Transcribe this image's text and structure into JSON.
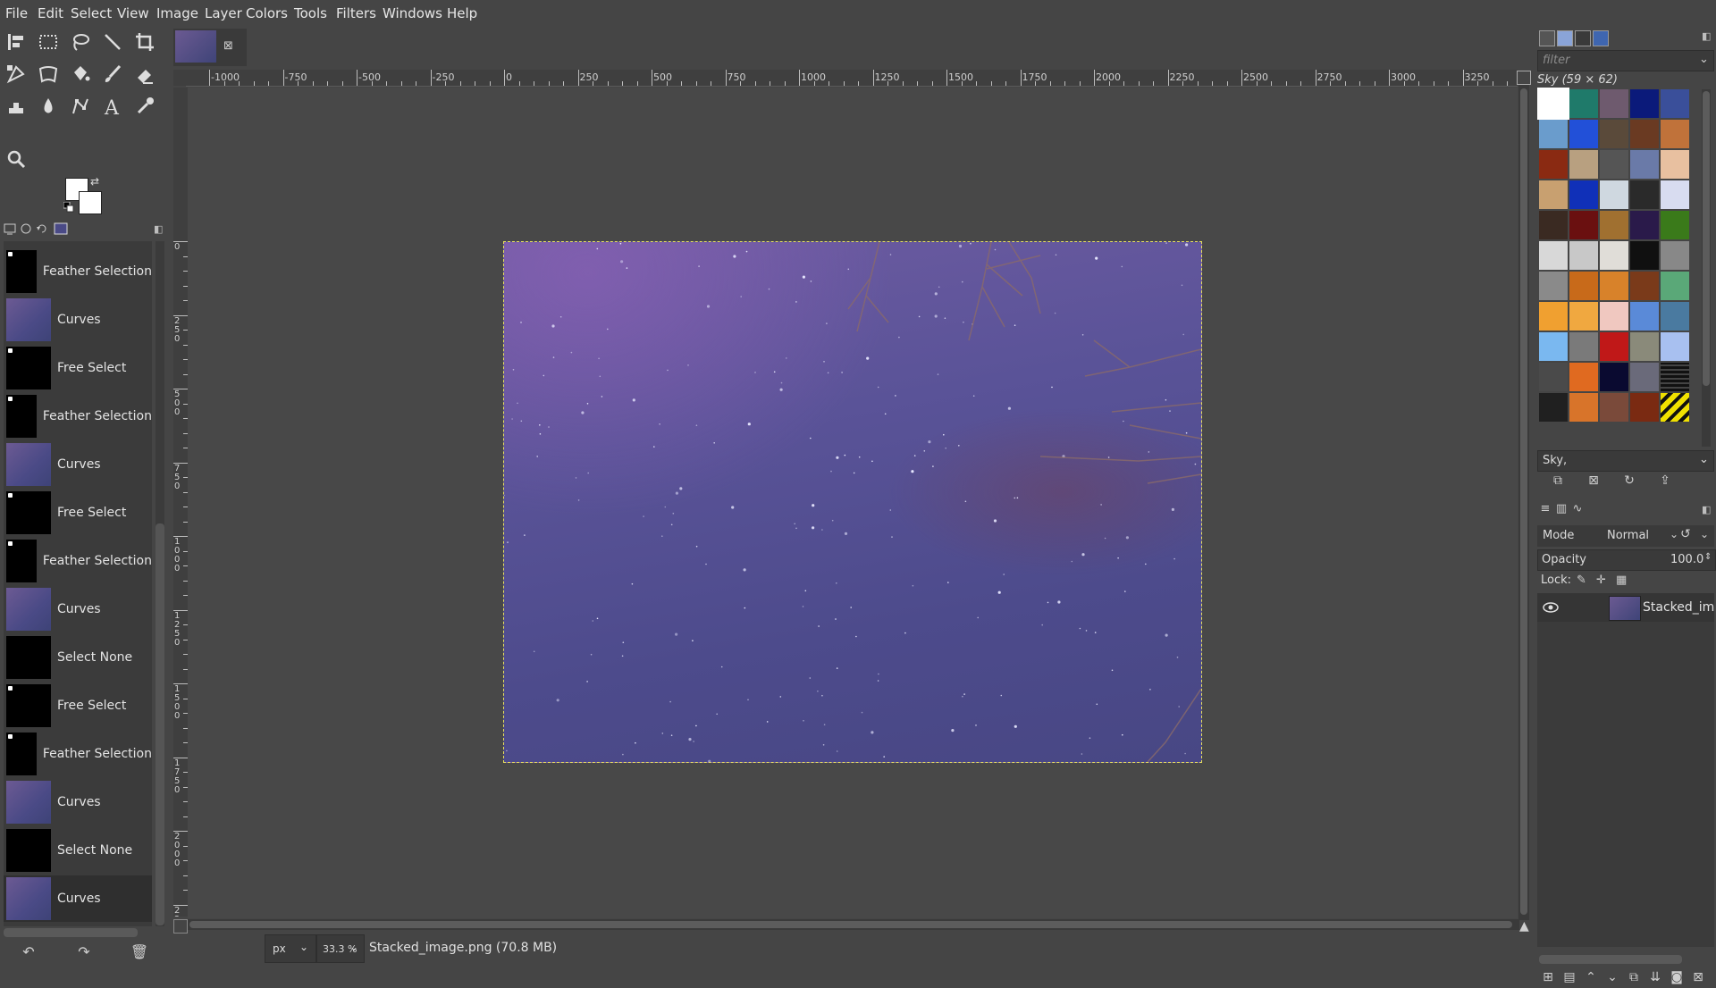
{
  "menubar": {
    "items": [
      "File",
      "Edit",
      "Select",
      "View",
      "Image",
      "Layer",
      "Colors",
      "Tools",
      "Filters",
      "Windows",
      "Help"
    ]
  },
  "toolbox": {
    "tools": [
      "align-icon",
      "rect-select-icon",
      "lasso-icon",
      "fuzzy-select-icon",
      "crop-icon",
      "unified-transform-icon",
      "warp-icon",
      "bucket-fill-icon",
      "paintbrush-icon",
      "eraser-icon",
      "clone-icon",
      "smudge-icon",
      "paths-icon",
      "text-icon",
      "color-picker-icon",
      "zoom-icon"
    ],
    "fg_color": "#ffffff",
    "bg_color": "#ffffff"
  },
  "history": {
    "items": [
      {
        "label": "Feather Selection",
        "thumb": "black-sel"
      },
      {
        "label": "Curves",
        "thumb": "sky"
      },
      {
        "label": "Free Select",
        "thumb": "black-sel"
      },
      {
        "label": "Feather Selection",
        "thumb": "black-sel"
      },
      {
        "label": "Curves",
        "thumb": "sky"
      },
      {
        "label": "Free Select",
        "thumb": "black-sel"
      },
      {
        "label": "Feather Selection",
        "thumb": "black-sel"
      },
      {
        "label": "Curves",
        "thumb": "sky"
      },
      {
        "label": "Select None",
        "thumb": "black"
      },
      {
        "label": "Free Select",
        "thumb": "black-sel"
      },
      {
        "label": "Feather Selection",
        "thumb": "black-sel"
      },
      {
        "label": "Curves",
        "thumb": "sky"
      },
      {
        "label": "Select None",
        "thumb": "black"
      },
      {
        "label": "Curves",
        "thumb": "sky",
        "active": true
      }
    ],
    "buttons": [
      "undo-icon",
      "redo-icon",
      "clear-history-icon"
    ]
  },
  "image_window": {
    "tab_close": "⊠",
    "ruler_labels": [
      "-1000",
      "-750",
      "-500",
      "-250",
      "0",
      "250",
      "500",
      "750",
      "1000",
      "1250",
      "1500",
      "1750",
      "2000",
      "2250",
      "2500",
      "2750",
      "3000",
      "3250"
    ],
    "vruler_labels": [
      "0",
      "250",
      "500",
      "750",
      "1000",
      "1250",
      "1500",
      "1750",
      "2000",
      "2250"
    ]
  },
  "statusbar": {
    "unit": "px",
    "zoom": "33.3 %",
    "text": "Stacked_image.png (70.8 MB)"
  },
  "patterns": {
    "filter_placeholder": "filter",
    "selected_name": "Sky (59 × 62)",
    "select_value": "Sky,"
  },
  "layers": {
    "mode_label": "Mode",
    "mode_value": "Normal",
    "opacity_label": "Opacity",
    "opacity_value": "100.0",
    "lock_label": "Lock:",
    "layer_name": "Stacked_image.png"
  },
  "colors": {
    "accent_selection": "#e8e05c",
    "ui_bg": "#454545",
    "panel_bg": "#3b3b3b"
  }
}
